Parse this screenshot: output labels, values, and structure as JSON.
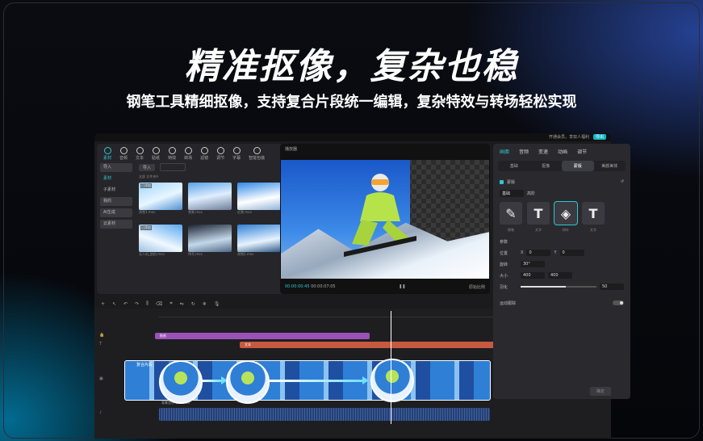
{
  "headline": "精准抠像，复杂也稳",
  "subline": "钢笔工具精细抠像，支持复合片段统一编辑，复杂特效与转场轻松实现",
  "titlebar": {
    "login": "开通会员，享双人福利",
    "pill": "导出"
  },
  "media": {
    "tabs": [
      "素材",
      "音频",
      "文本",
      "贴纸",
      "特效",
      "转场",
      "滤镜",
      "调节",
      "字幕",
      "智能包装",
      "滤镜"
    ],
    "active_tab": "素材",
    "sidebar": [
      "导入",
      "素材",
      "子素材",
      "我的",
      "AI生成",
      "云素材"
    ],
    "import_label": "导入",
    "crumbs": "全部   文件夹A",
    "thumbs": [
      {
        "tag": "已添加",
        "caption": "滑雪1.mov"
      },
      {
        "tag": "",
        "caption": "雪景.mov"
      },
      {
        "tag": "",
        "caption": "近景.mov"
      },
      {
        "tag": "已添加",
        "caption": "无人机_航拍.mov"
      },
      {
        "tag": "",
        "caption": "特写.mov"
      },
      {
        "tag": "",
        "caption": "滑雪2.mov"
      }
    ]
  },
  "player": {
    "title": "播放器",
    "time_current": "00:00:00:45",
    "time_total": "00:00:07:05",
    "ratio": "原始比例"
  },
  "inspector": {
    "tabs": [
      "画面",
      "音频",
      "变速",
      "动画",
      "调节"
    ],
    "active_tab": "画面",
    "subtabs": [
      "基础",
      "抠像",
      "蒙版",
      "美颜美体"
    ],
    "active_subtab": "蒙版",
    "mask_label": "蒙版",
    "mask_modes": [
      "基础",
      "高阶"
    ],
    "shapes": [
      {
        "glyph": "✎",
        "caption": "钢笔"
      },
      {
        "glyph": "T",
        "caption": "文字"
      },
      {
        "glyph": "◈",
        "caption": "树叶"
      },
      {
        "glyph": "T",
        "caption": "文字"
      }
    ],
    "params_label": "参数",
    "position_label": "位置",
    "x": "0",
    "y": "0",
    "rotation_label": "旋转",
    "rotation": "30°",
    "size_label": "大小",
    "width": "400",
    "height": "400",
    "feather_label": "羽化",
    "feather": "50",
    "motion_label": "运动跟踪",
    "export_btn": "确定"
  },
  "timeline": {
    "track1": "贴纸",
    "track2": "文本",
    "main_clip": "复合片段",
    "audio_label": "背景音乐  00:00:00"
  }
}
